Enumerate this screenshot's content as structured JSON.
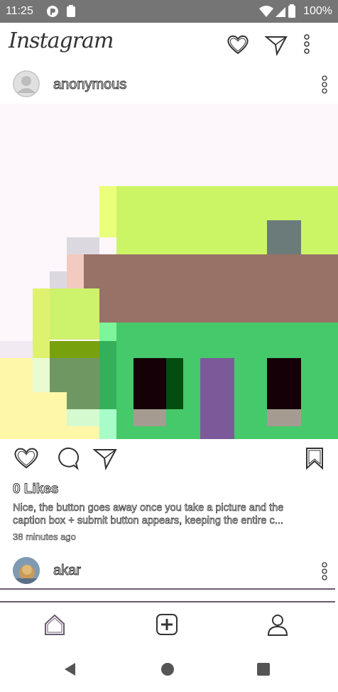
{
  "status_bar": {
    "time": "11:25",
    "battery": "100%",
    "icons": [
      "app-notification-icon",
      "clipboard-icon",
      "wifi-icon",
      "signal-icon",
      "battery-icon"
    ]
  },
  "app_bar": {
    "title": "Instagram",
    "icons": [
      "heart-icon",
      "send-icon",
      "more-vert-icon"
    ]
  },
  "post": {
    "username": "anonymous",
    "likes": "0 Likes",
    "caption_line1": "Nice, the button goes away once you take a picture and the",
    "caption_line2": "caption box + submit button appears, keeping the entire c...",
    "time_ago": "38 minutes ago",
    "action_icons": [
      "like-icon",
      "comment-icon",
      "share-icon",
      "bookmark-icon"
    ]
  },
  "next_post": {
    "username": "akar"
  },
  "bottom_nav": {
    "items": [
      "home-icon",
      "add-post-icon",
      "profile-icon"
    ]
  },
  "system_nav": [
    "back-icon",
    "home-circle-icon",
    "recents-icon"
  ],
  "colors": {
    "status_bar": "#757575",
    "accent_purple": "#6a5a70",
    "photo_bg": "#fdf6fb"
  }
}
